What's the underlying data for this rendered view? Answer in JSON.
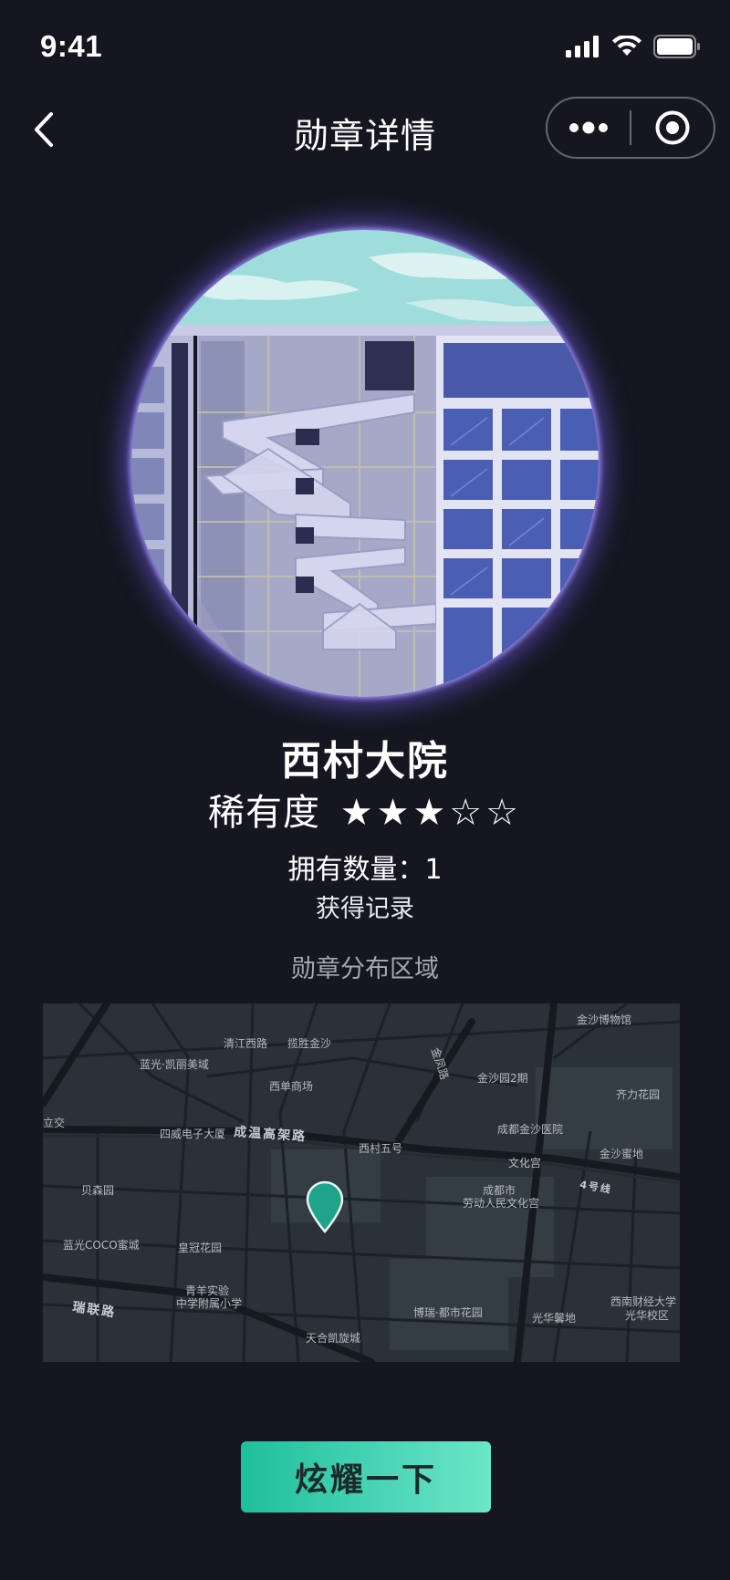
{
  "status_bar": {
    "time": "9:41",
    "icons": [
      "signal-icon",
      "wifi-icon",
      "battery-icon"
    ]
  },
  "nav": {
    "title": "勋章详情",
    "back_icon": "chevron-left-icon",
    "more_icon": "more-dots-icon",
    "close_icon": "target-circle-icon"
  },
  "badge": {
    "name": "西村大院",
    "rarity_label": "稀有度",
    "rarity": 3,
    "rarity_max": 5,
    "stars_text": "★★★☆☆",
    "owned_label": "拥有数量：",
    "owned_count": "1",
    "record_link": "获得记录"
  },
  "map_section": {
    "title": "勋章分布区域",
    "pin_color": "#1fa38b",
    "labels": [
      "金沙博物馆",
      "清江西路",
      "揽胜金沙",
      "蓝光·凯丽美域",
      "金凤路",
      "金沙园2期",
      "西单商场",
      "齐力花园",
      "立交",
      "四威电子大厦",
      "成温高架路",
      "成都金沙医院",
      "西村五号",
      "文化宫",
      "金沙蜜地",
      "4号线",
      "贝森园",
      "成都市",
      "劳动人民文化宫",
      "蓝光COCO蜜城",
      "皇冠花园",
      "青羊实验",
      "中学附属小学",
      "瑞联路",
      "博瑞·都市花园",
      "光华馨地",
      "西南财经大学",
      "光华校区",
      "天合凯旋城"
    ]
  },
  "action": {
    "button_label": "炫耀一下"
  },
  "colors": {
    "background": "#161621",
    "accent_start": "#1fbf9b",
    "accent_end": "#6be6c9",
    "badge_glow": "#7c68ff"
  }
}
